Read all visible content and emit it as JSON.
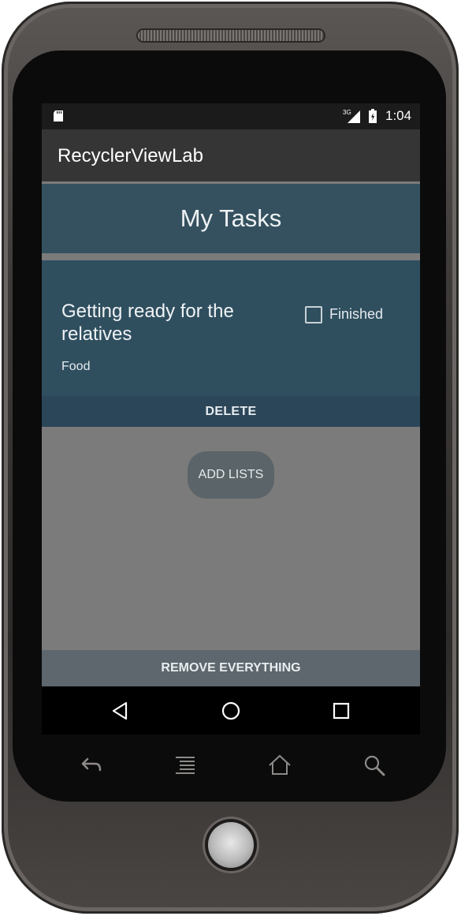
{
  "status_bar": {
    "network": "3G",
    "time": "1:04"
  },
  "app": {
    "title": "RecyclerViewLab"
  },
  "header": {
    "title": "My Tasks"
  },
  "task": {
    "title": "Getting ready for the relatives",
    "category": "Food",
    "finished_label": "Finished",
    "finished": false
  },
  "actions": {
    "delete_label": "DELETE",
    "add_lists_label": "ADD LISTS",
    "remove_everything_label": "REMOVE EVERYTHING"
  },
  "nav": {
    "back_icon": "back-triangle-icon",
    "home_icon": "home-circle-icon",
    "recents_icon": "recents-square-icon"
  },
  "hardware_keys": [
    "back-arrow-icon",
    "menu-icon",
    "home-icon",
    "search-icon"
  ],
  "colors": {
    "status_bar": "#1b1b1b",
    "action_bar": "#353535",
    "header": "#35515f",
    "card": "#2f4f5f",
    "delete_bar": "#2c4659",
    "content": "#7b7b7b",
    "remove_bar": "#5d676d"
  }
}
